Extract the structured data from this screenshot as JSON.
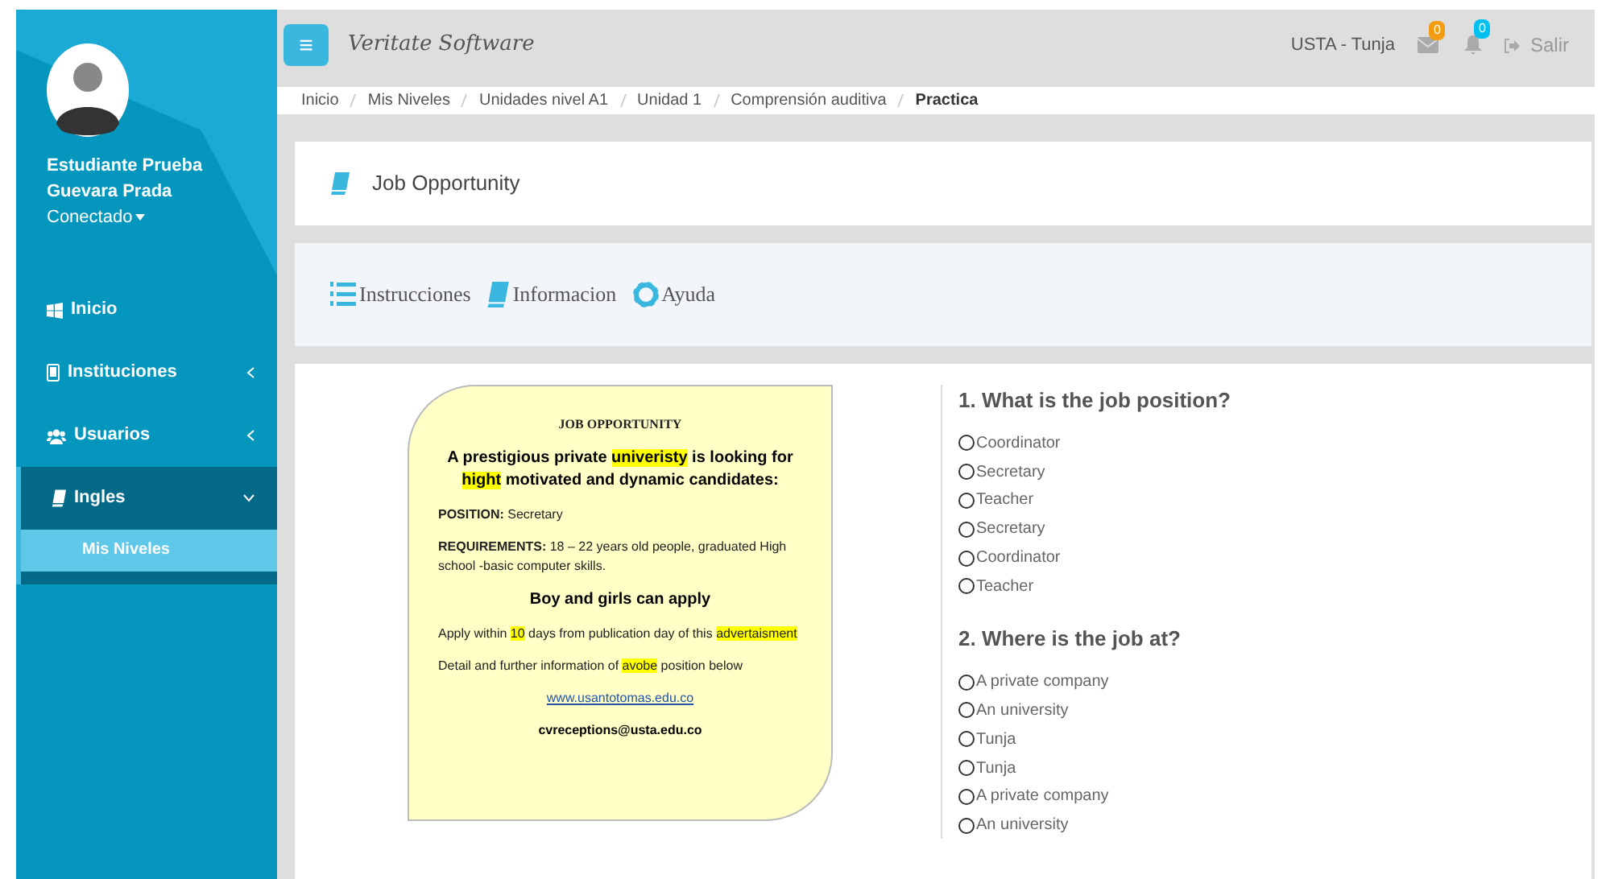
{
  "sidebar": {
    "user": {
      "name_line_1": "Estudiante Prueba",
      "name_line_2": "Guevara Prada",
      "status": "Conectado"
    },
    "items": [
      {
        "kind": "link",
        "label": "Inicio",
        "selected": false
      },
      {
        "kind": "group",
        "label": "Instituciones",
        "selected": false,
        "expanded": false
      },
      {
        "kind": "group",
        "label": "Usuarios",
        "selected": false,
        "expanded": false
      },
      {
        "kind": "group",
        "label": "Ingles",
        "selected": true,
        "expanded": true,
        "children": [
          {
            "label": "Mis Niveles",
            "selected": true
          }
        ]
      }
    ]
  },
  "header": {
    "menu_glyph": "≡",
    "brand": "Veritate Software",
    "location": "USTA - Tunja",
    "mail_count": "0",
    "alert_count": "0",
    "logout": "Salir"
  },
  "breadcrumb": [
    "Inicio",
    "Mis Niveles",
    "Unidades nivel A1",
    "Unidad 1",
    "Comprensión auditiva",
    "Practica"
  ],
  "title": "Job Opportunity",
  "tools": [
    {
      "label": "Instrucciones"
    },
    {
      "label": "Informacion"
    },
    {
      "label": "Ayuda"
    }
  ],
  "ad": {
    "paragraphs": [
      {
        "kind": "heading",
        "segments": [
          {
            "text": "JOB OPPORTUNITY",
            "highlight": false
          }
        ]
      },
      {
        "kind": "lead",
        "segments": [
          {
            "text": "A prestigious  private ",
            "highlight": false
          },
          {
            "text": "univeristy",
            "highlight": true
          },
          {
            "text": " is looking for ",
            "highlight": false
          },
          {
            "text": "hight",
            "highlight": true
          },
          {
            "text": " motivated and dynamic candidates:",
            "highlight": false
          }
        ]
      },
      {
        "kind": "body",
        "segments": [
          {
            "text": "**POSITION:** Secretary",
            "highlight": false
          }
        ]
      },
      {
        "kind": "body",
        "segments": [
          {
            "text": "**REQUIREMENTS:** 18 – 22 years old people, graduated High school -basic computer skills.",
            "highlight": false
          }
        ]
      },
      {
        "kind": "lead",
        "segments": [
          {
            "text": "Boy and girls can apply",
            "highlight": false
          }
        ]
      },
      {
        "kind": "body",
        "segments": [
          {
            "text": "Apply within ",
            "highlight": false
          },
          {
            "text": "10",
            "highlight": true
          },
          {
            "text": " days from publication day of this ",
            "highlight": false
          },
          {
            "text": "advertaisment",
            "highlight": true
          }
        ]
      },
      {
        "kind": "body",
        "segments": [
          {
            "text": "Detail and further information of ",
            "highlight": false
          },
          {
            "text": "avobe",
            "highlight": true
          },
          {
            "text": " position below",
            "highlight": false
          }
        ]
      },
      {
        "kind": "link",
        "segments": [
          {
            "text": "www.usantotomas.edu.co",
            "highlight": false
          }
        ]
      },
      {
        "kind": "email",
        "segments": [
          {
            "text": "cvreceptions@usta.edu.co",
            "highlight": false
          }
        ]
      }
    ]
  },
  "questions": [
    {
      "text": "1. What is the job position?",
      "options": [
        {
          "label": "Coordinator",
          "selected": false
        },
        {
          "label": "Secretary",
          "selected": false
        },
        {
          "label": "Teacher",
          "selected": false
        },
        {
          "label": "Secretary",
          "selected": false
        },
        {
          "label": "Coordinator",
          "selected": false
        },
        {
          "label": "Teacher",
          "selected": false
        }
      ]
    },
    {
      "text": "2. Where is the job at?",
      "options": [
        {
          "label": "A private company",
          "selected": false
        },
        {
          "label": "An university",
          "selected": false
        },
        {
          "label": "Tunja",
          "selected": false
        },
        {
          "label": "Tunja",
          "selected": false
        },
        {
          "label": "A private company",
          "selected": false
        },
        {
          "label": "An university",
          "selected": false
        }
      ]
    }
  ]
}
